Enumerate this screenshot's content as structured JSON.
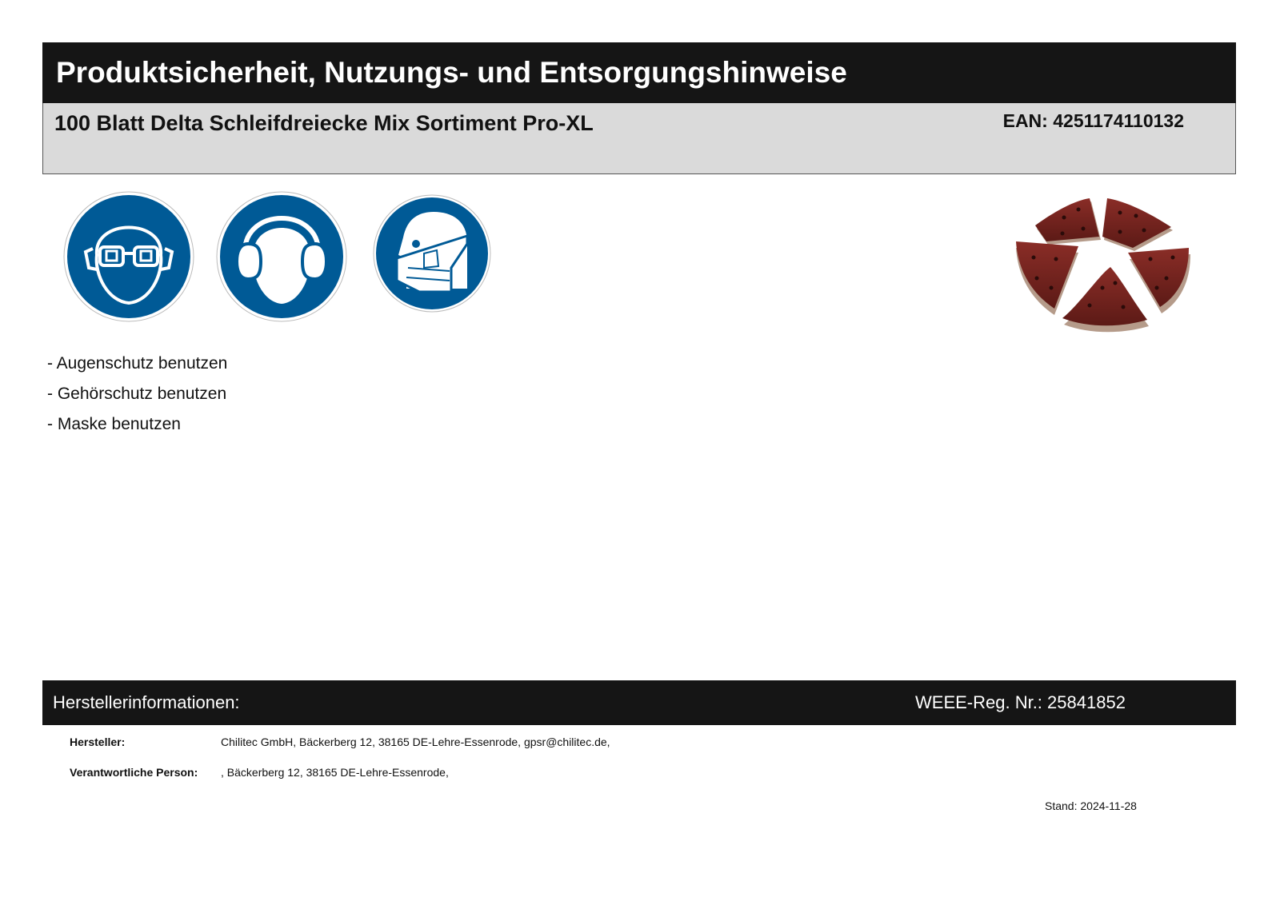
{
  "header": {
    "title": "Produktsicherheit, Nutzungs- und Entsorgungshinweise",
    "product_name": "100 Blatt Delta Schleifdreiecke Mix Sortiment Pro-XL",
    "ean_label": "EAN:",
    "ean_value": "4251174110132"
  },
  "signs": [
    {
      "icon": "eye-protection-icon",
      "color": "#005a96"
    },
    {
      "icon": "hearing-protection-icon",
      "color": "#005a96"
    },
    {
      "icon": "mask-icon",
      "color": "#005a96"
    }
  ],
  "product_image": {
    "icon": "sanding-triangles-image"
  },
  "instructions": [
    "- Augenschutz benutzen",
    "- Gehörschutz benutzen",
    "- Maske benutzen"
  ],
  "manufacturer": {
    "section_title": "Herstellerinformationen:",
    "weee_label": "WEEE-Reg. Nr.:",
    "weee_number": "25841852",
    "manufacturer_label": "Hersteller:",
    "manufacturer_value": "Chilitec GmbH, Bäckerberg 12, 38165 DE-Lehre-Essenrode, gpsr@chilitec.de,",
    "responsible_label": "Verantwortliche Person:",
    "responsible_value": ", Bäckerberg 12, 38165 DE-Lehre-Essenrode,"
  },
  "footer": {
    "stand_label": "Stand:",
    "stand_date": "2024-11-28"
  }
}
